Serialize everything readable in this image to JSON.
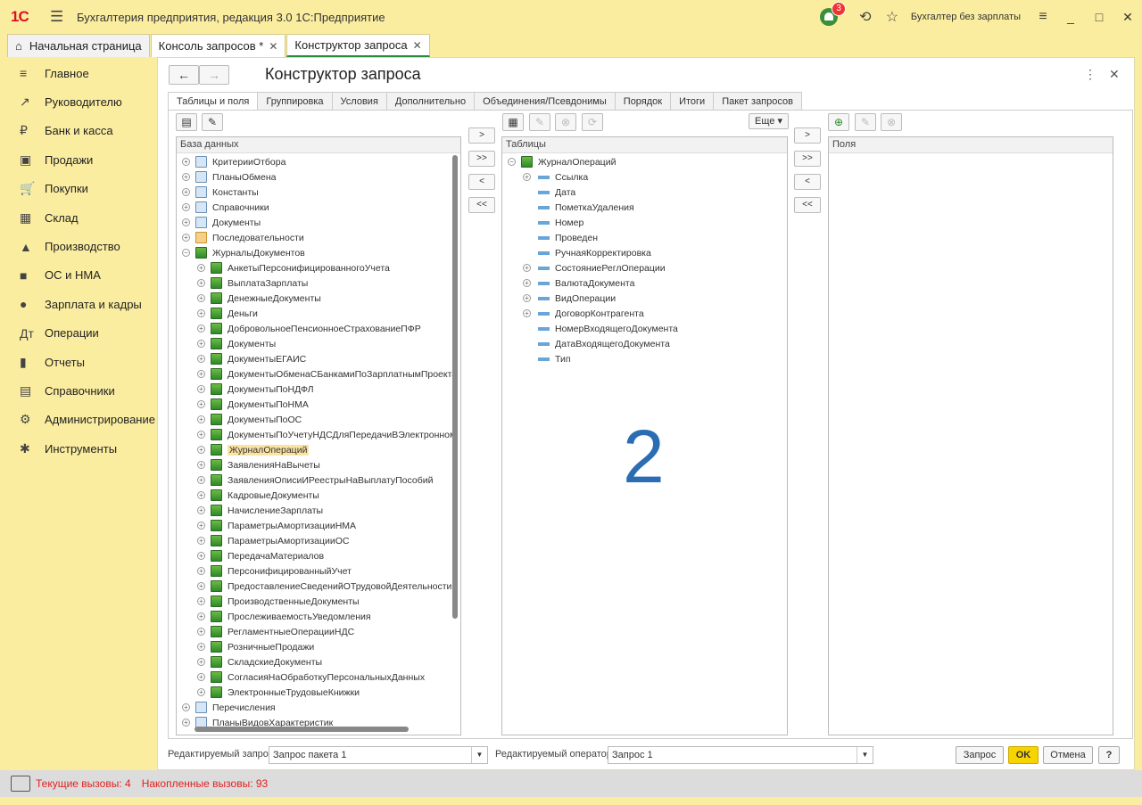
{
  "app": {
    "logo": "1С",
    "title": "Бухгалтерия предприятия, редакция 3.0 1С:Предприятие",
    "notifications": "3",
    "user": "Бухгалтер без зарплаты"
  },
  "tabs": [
    {
      "label": "Начальная страница"
    },
    {
      "label": "Консоль запросов *"
    },
    {
      "label": "Конструктор запроса"
    }
  ],
  "sidebar": {
    "items": [
      {
        "label": "Главное",
        "icon": "≡"
      },
      {
        "label": "Руководителю",
        "icon": "↗"
      },
      {
        "label": "Банк и касса",
        "icon": "₽"
      },
      {
        "label": "Продажи",
        "icon": "▣"
      },
      {
        "label": "Покупки",
        "icon": "🛒"
      },
      {
        "label": "Склад",
        "icon": "▦"
      },
      {
        "label": "Производство",
        "icon": "▲"
      },
      {
        "label": "ОС и НМА",
        "icon": "■"
      },
      {
        "label": "Зарплата и кадры",
        "icon": "●"
      },
      {
        "label": "Операции",
        "icon": "Дт"
      },
      {
        "label": "Отчеты",
        "icon": "▮"
      },
      {
        "label": "Справочники",
        "icon": "▤"
      },
      {
        "label": "Администрирование",
        "icon": "⚙"
      },
      {
        "label": "Инструменты",
        "icon": "✱"
      }
    ]
  },
  "page": {
    "title": "Конструктор запроса"
  },
  "qtabs": [
    {
      "label": "Таблицы и поля"
    },
    {
      "label": "Группировка"
    },
    {
      "label": "Условия"
    },
    {
      "label": "Дополнительно"
    },
    {
      "label": "Объединения/Псевдонимы"
    },
    {
      "label": "Порядок"
    },
    {
      "label": "Итоги"
    },
    {
      "label": "Пакет запросов"
    }
  ],
  "db": {
    "header": "База данных",
    "top": [
      {
        "label": "КритерииОтбора",
        "exp": "+"
      },
      {
        "label": "ПланыОбмена",
        "exp": "+"
      },
      {
        "label": "Константы",
        "exp": "+"
      },
      {
        "label": "Справочники",
        "exp": "+"
      },
      {
        "label": "Документы",
        "exp": "+"
      },
      {
        "label": "Последовательности",
        "exp": "+"
      },
      {
        "label": "ЖурналыДокументов",
        "exp": "−"
      }
    ],
    "journals": [
      "АнкетыПерсонифицированногоУчета",
      "ВыплатаЗарплаты",
      "ДенежныеДокументы",
      "Деньги",
      "ДобровольноеПенсионноеСтрахованиеПФР",
      "Документы",
      "ДокументыЕГАИС",
      "ДокументыОбменаСБанкамиПоЗарплатнымПроекта",
      "ДокументыПоНДФЛ",
      "ДокументыПоНМА",
      "ДокументыПоОС",
      "ДокументыПоУчетуНДСДляПередачиВЭлектронном",
      "ЖурналОпераций",
      "ЗаявленияНаВычеты",
      "ЗаявленияОписиИРеестрыНаВыплатуПособий",
      "КадровыеДокументы",
      "НачислениеЗарплаты",
      "ПараметрыАмортизацииНМА",
      "ПараметрыАмортизацииОС",
      "ПередачаМатериалов",
      "ПерсонифицированныйУчет",
      "ПредоставлениеСведенийОТрудовойДеятельности",
      "ПроизводственныеДокументы",
      "ПрослеживаемостьУведомления",
      "РегламентныеОперацииНДС",
      "РозничныеПродажи",
      "СкладскиеДокументы",
      "СогласияНаОбработкуПерсональныхДанных",
      "ЭлектронныеТрудовыеКнижки"
    ],
    "selected": "ЖурналОпераций",
    "after": [
      {
        "label": "Перечисления",
        "exp": "+"
      },
      {
        "label": "ПланыВидовХарактеристик",
        "exp": "+"
      }
    ]
  },
  "tables": {
    "header": "Таблицы",
    "root": "ЖурналОпераций",
    "fields": [
      {
        "label": "Ссылка",
        "exp": "+"
      },
      {
        "label": "Дата",
        "exp": ""
      },
      {
        "label": "ПометкаУдаления",
        "exp": ""
      },
      {
        "label": "Номер",
        "exp": ""
      },
      {
        "label": "Проведен",
        "exp": ""
      },
      {
        "label": "РучнаяКорректировка",
        "exp": ""
      },
      {
        "label": "СостояниеРеглОперации",
        "exp": "+"
      },
      {
        "label": "ВалютаДокумента",
        "exp": "+"
      },
      {
        "label": "ВидОперации",
        "exp": "+"
      },
      {
        "label": "ДоговорКонтрагента",
        "exp": "+"
      },
      {
        "label": "НомерВходящегоДокумента",
        "exp": ""
      },
      {
        "label": "ДатаВходящегоДокумента",
        "exp": ""
      },
      {
        "label": "Тип",
        "exp": ""
      }
    ]
  },
  "fields_panel": {
    "header": "Поля"
  },
  "more_label": "Еще",
  "arrows": {
    "one": ">",
    "all": ">>",
    "back": "<",
    "backall": "<<"
  },
  "big_number": "2",
  "bottom": {
    "query_label": "Редактируемый запрос:",
    "query_value": "Запрос пакета 1",
    "op_label": "Редактируемый оператор:",
    "op_value": "Запрос 1",
    "btn_query": "Запрос",
    "btn_ok": "OK",
    "btn_cancel": "Отмена",
    "btn_help": "?"
  },
  "status": {
    "current": "Текущие вызовы: 4",
    "accum": "Накопленные вызовы: 93"
  }
}
